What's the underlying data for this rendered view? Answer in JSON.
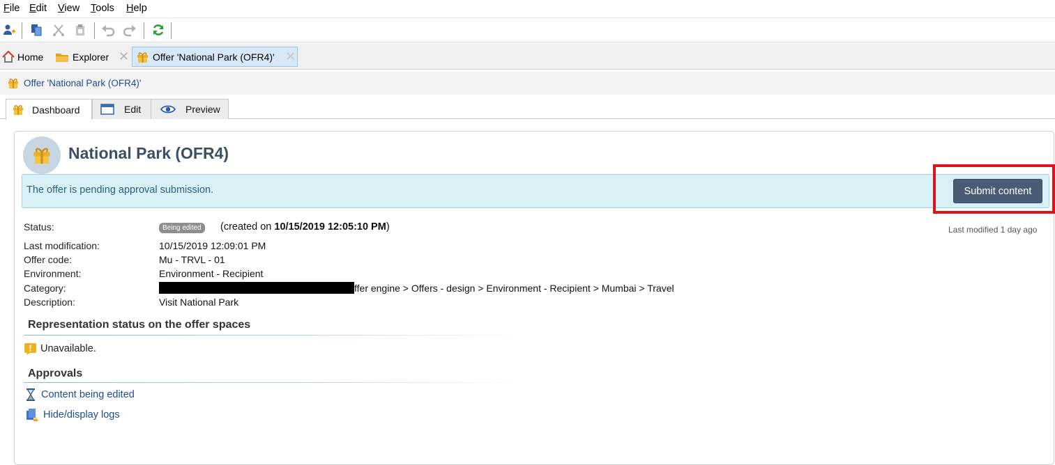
{
  "menu": [
    {
      "label": "File",
      "key": "F"
    },
    {
      "label": "Edit",
      "key": "E"
    },
    {
      "label": "View",
      "key": "V"
    },
    {
      "label": "Tools",
      "key": "T"
    },
    {
      "label": "Help",
      "key": "H"
    }
  ],
  "tabs": {
    "home": "Home",
    "explorer": "Explorer",
    "offer": "Offer 'National Park (OFR4)'"
  },
  "breadcrumb": "Offer 'National Park (OFR4)'",
  "subtabs": {
    "dashboard": "Dashboard",
    "edit": "Edit",
    "preview": "Preview"
  },
  "offer": {
    "title": "National Park (OFR4)",
    "banner_text": "The offer is pending approval submission.",
    "submit_label": "Submit content",
    "last_modified_relative": "Last modified 1 day ago",
    "fields": {
      "status_label": "Status:",
      "status_badge": "Being edited",
      "created_prefix": "(created on ",
      "created_date": "10/15/2019 12:05:10 PM",
      "created_suffix": ")",
      "last_modification_label": "Last modification:",
      "last_modification_value": "10/15/2019 12:09:01 PM",
      "offer_code_label": "Offer code:",
      "offer_code_value": "Mu - TRVL - 01",
      "environment_label": "Environment:",
      "environment_value": "Environment - Recipient",
      "category_label": "Category:",
      "category_value": "ffer engine > Offers - design > Environment - Recipient > Mumbai > Travel",
      "description_label": "Description:",
      "description_value": "Visit National Park"
    },
    "representation": {
      "title": "Representation status on the offer spaces",
      "status": "Unavailable."
    },
    "approvals": {
      "title": "Approvals",
      "content_link": "Content being edited",
      "logs_link": "Hide/display logs"
    }
  },
  "colors": {
    "banner_bg": "#d9f0f7",
    "banner_border": "#9fd3e5",
    "submit_bg": "#4a5b75",
    "highlight_box": "#e0131c",
    "gift": "#e9b12a",
    "link": "#1d4d8f"
  },
  "icons": [
    "add-user-icon",
    "copy-icon",
    "cut-icon",
    "paste-icon",
    "undo-icon",
    "redo-icon",
    "refresh-icon",
    "home-icon",
    "folder-icon",
    "close-icon",
    "gift-icon",
    "window-icon",
    "eye-icon",
    "warning-icon",
    "hourglass-icon",
    "logs-icon"
  ]
}
